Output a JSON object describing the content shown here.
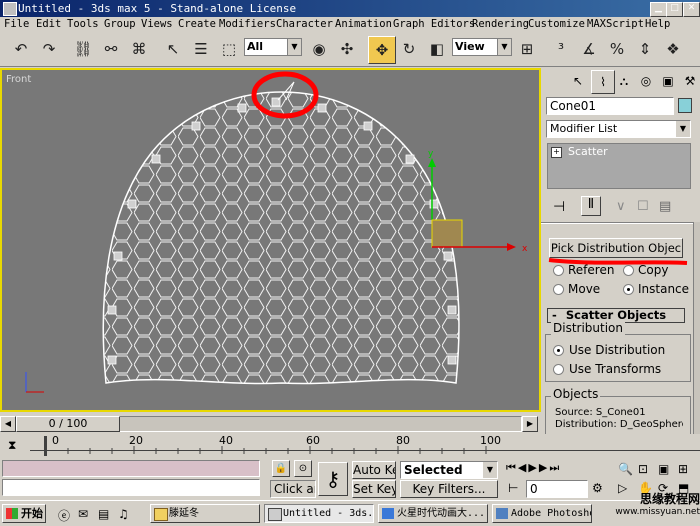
{
  "window": {
    "title": "Untitled - 3ds max 5 - Stand-alone License"
  },
  "menu": [
    "File",
    "Edit",
    "Tools",
    "Group",
    "Views",
    "Create",
    "Modifiers",
    "Character",
    "Animation",
    "Graph Editors",
    "Rendering",
    "Customize",
    "MAXScript",
    "Help"
  ],
  "toolbar": {
    "selection_filter": "All",
    "ref_coord": "View"
  },
  "viewport": {
    "label": "Front"
  },
  "panel": {
    "object_name": "Cone01",
    "modifier_list": "Modifier List",
    "stack_item": "Scatter",
    "pick_button": "Pick Distribution Objec",
    "radio": {
      "reference": "Referen",
      "copy": "Copy",
      "move": "Move",
      "instance": "Instance"
    },
    "rollout_title": "Scatter Objects",
    "distribution_group": "Distribution",
    "use_distribution": "Use Distribution",
    "use_transforms": "Use Transforms",
    "objects_group": "Objects",
    "source": "Source: S_Cone01",
    "distribution": "Distribution: D_GeoSphere"
  },
  "timeline": {
    "slider": "0 / 100",
    "ticks": [
      "0",
      "20",
      "40",
      "60",
      "80",
      "100"
    ]
  },
  "bottom": {
    "click_hint": "Click ar",
    "auto_key": "Auto Key",
    "set_key": "Set Key",
    "key_mode": "Selected",
    "key_filters": "Key Filters...",
    "frame": "0"
  },
  "taskbar": {
    "start": "开始",
    "tasks": [
      "滕延冬",
      "Untitled - 3ds...",
      "火星时代动画大...",
      "Adobe Photoshop"
    ],
    "watermark_cn": "思缘教程网",
    "watermark_url": "www.missyuan.net"
  },
  "colors": {
    "title_bar": "#0a246a",
    "viewport_bg": "#787878",
    "active_border": "#e8d800",
    "annotation": "#ff0000"
  }
}
